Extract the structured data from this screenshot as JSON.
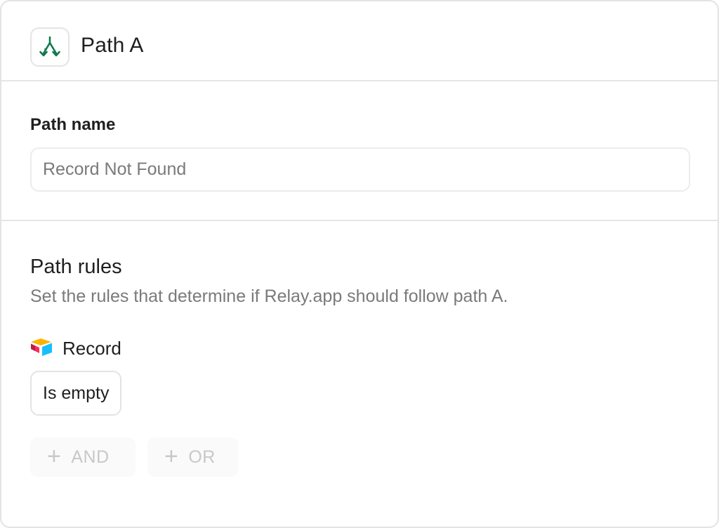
{
  "header": {
    "title": "Path A",
    "icon": "split-path-icon",
    "icon_color": "#0f7a4f"
  },
  "path_name": {
    "label": "Path name",
    "placeholder": "Record Not Found",
    "value": ""
  },
  "rules": {
    "title": "Path rules",
    "description": "Set the rules that determine if Relay.app should follow path A.",
    "field": {
      "icon": "airtable-icon",
      "label": "Record"
    },
    "condition": "Is empty",
    "buttons": {
      "and_label": "AND",
      "or_label": "OR"
    }
  }
}
